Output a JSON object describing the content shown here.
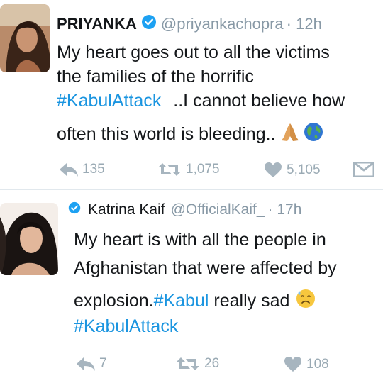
{
  "tweets": [
    {
      "name": "PRIYANKA",
      "handle": "@priyankachopra",
      "time": "· 12h",
      "lines": [
        "My heart goes out to all the victims",
        "the families of the horrific",
        "#KabulAttack",
        "..I cannot believe how",
        "often this world is bleeding.."
      ],
      "emoji": [
        "folded-hands-icon",
        "earth-globe-icon"
      ],
      "actions": {
        "reply": "135",
        "retweet": "1,075",
        "like": "5,105"
      }
    },
    {
      "name": "Katrina Kaif",
      "handle": "@OfficialKaif_",
      "time": "· 17h",
      "lines": [
        "My heart is with all the people in",
        "Afghanistan that were affected by",
        "explosion.",
        "#Kabul",
        " really sad",
        "#KabulAttack"
      ],
      "emoji": [
        "sad-face-icon"
      ],
      "actions": {
        "reply": "7",
        "retweet": "26",
        "like": "108"
      }
    }
  ],
  "colors": {
    "hashtag": "#1b95e0",
    "verified": "#1da1f2",
    "meta": "#8899a6",
    "action": "#9aaab4",
    "text": "#14171a"
  }
}
